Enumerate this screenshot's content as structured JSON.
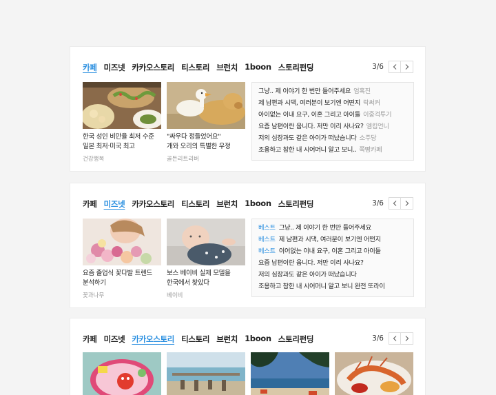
{
  "tab_labels": [
    "카페",
    "미즈넷",
    "카카오스토리",
    "티스토리",
    "브런치",
    "1boon",
    "스토리펀딩"
  ],
  "cards": [
    {
      "page": "3/6",
      "articles": [
        {
          "caption_line1": "한국 성인 비만율 최저 수준",
          "caption_line2": "일본 최저·미국 최고",
          "source": "건강행복"
        },
        {
          "caption_line1": "\"싸우다 정들었어요\"",
          "caption_line2": "개와 오리의 특별한 우정",
          "source": "골든리트리버"
        }
      ],
      "list": [
        {
          "title": "그냥.. 제 이야기 한 번만 들어주세요",
          "author": "엄혹진"
        },
        {
          "title": "제 남편과 시댁, 여러분이 보기엔 어떤지",
          "author": "락써커"
        },
        {
          "title": "아이없는 이내 요구, 이혼 그리고 아이들",
          "author": "이중걱투기"
        },
        {
          "title": "요즘 남편이란 웁니다. 저만 이리 사나요?",
          "author": "엠킴언니"
        },
        {
          "title": "저의 심장과도 같은 아이가 떠났습니다",
          "author": "소주당"
        },
        {
          "title": "조용하고 참한 내 시어머니 알고 보니..",
          "author": "쭉빵카페"
        }
      ]
    },
    {
      "page": "3/6",
      "articles": [
        {
          "caption_line1": "요즘 졸업식 꽃다발 트렌드",
          "caption_line2": "분석하기",
          "source": "꽃과나무"
        },
        {
          "caption_line1": "보스 베이비 실제 모델을",
          "caption_line2": "한국에서 찾았다",
          "source": "베이비"
        }
      ],
      "list": [
        {
          "badge": "베스트",
          "title": "그냥.. 제 이야기 한 번만 들어주세요"
        },
        {
          "badge": "베스트",
          "title": "제 남편과 시댁, 여러분이 보기엔 어떤지"
        },
        {
          "badge": "베스트",
          "title": "이어없는 이내 요구, 이혼 그리고 아이들"
        },
        {
          "title": "요즘 남편이란 웁니다. 저만 이리 사나요?"
        },
        {
          "title": "저의 심장과도 같은 아이가 떠났습니다"
        },
        {
          "title": "조용하고 참한 내 시어머니 알고 보니 완전 또라이"
        }
      ]
    },
    {
      "page": "3/6"
    }
  ],
  "colors": {
    "accent": "#2a8fe0",
    "background": "#f4f4f4",
    "card": "#ffffff",
    "muted": "#999999"
  },
  "icons": {
    "prev": "chevron-left-icon",
    "next": "chevron-right-icon"
  }
}
